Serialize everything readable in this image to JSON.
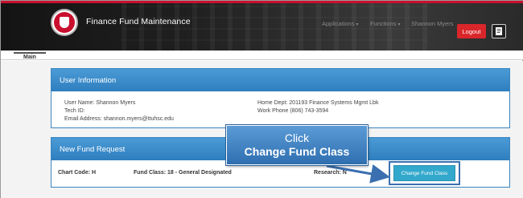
{
  "header": {
    "app_title": "Finance Fund Maintenance",
    "nav": [
      {
        "label": "Applications"
      },
      {
        "label": "Functions"
      }
    ],
    "user_name": "Shannon Myers",
    "logout_label": "Logout"
  },
  "tabs": [
    {
      "label": "Main"
    }
  ],
  "user_info": {
    "title": "User Information",
    "left": [
      "User Name: Shannon Myers",
      "Tech ID:",
      "Email Address: shannon.myers@ttuhsc.edu"
    ],
    "right": [
      "Home Dept: 201193 Finance Systems Mgmt Lbk",
      "Work Phone (806) 743-3594"
    ]
  },
  "new_fund": {
    "title": "New Fund Request",
    "chart_code": "Chart Code: H",
    "fund_class": "Fund Class: 18 - General Designated",
    "research": "Research: N",
    "change_button": "Change Fund Class"
  },
  "callout": {
    "line1": "Click",
    "line2": "Change Fund Class"
  },
  "colors": {
    "accent_red": "#c8102e",
    "panel_blue": "#2f7fbf",
    "button_cyan": "#32a8cc"
  }
}
